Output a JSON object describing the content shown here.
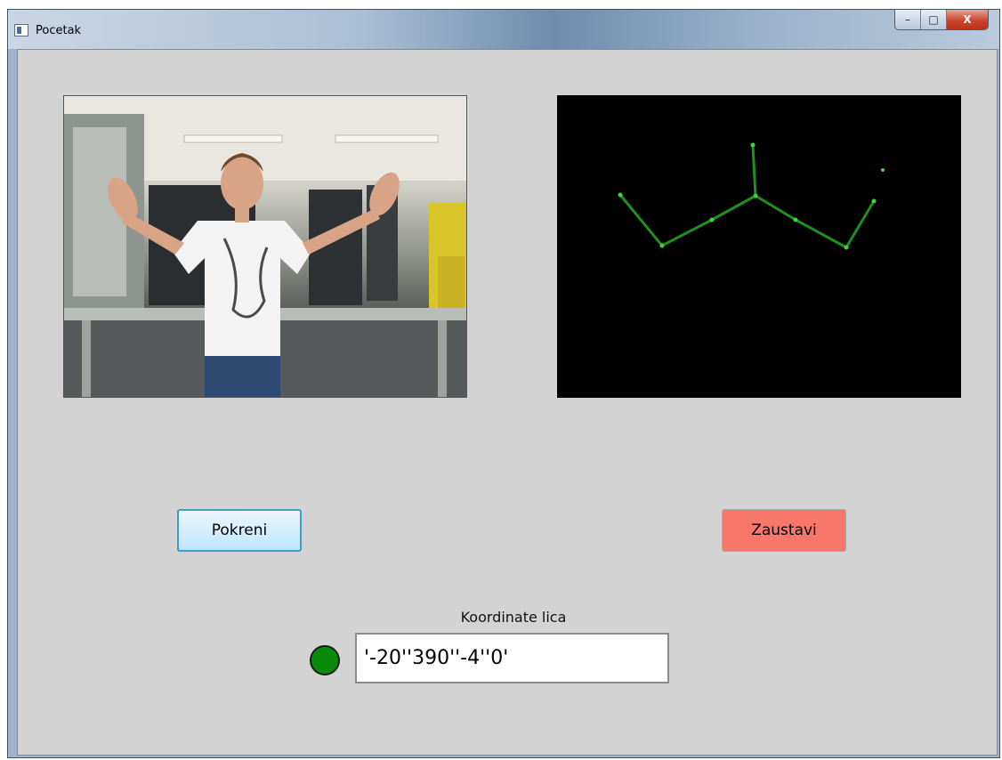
{
  "window": {
    "title": "Pocetak",
    "caption_buttons": {
      "minimize": "–",
      "maximize": "□",
      "close": "X"
    }
  },
  "views": {
    "camera": {
      "icon": "camera-feed"
    },
    "skeleton": {
      "icon": "skeleton-tracking",
      "line_color": "#1f8f1f",
      "joint_color": "#3fd43f"
    }
  },
  "buttons": {
    "start_label": "Pokreni",
    "stop_label": "Zaustavi"
  },
  "coordinates": {
    "label": "Koordinate lica",
    "value": "'-20''390''-4''0'",
    "status_color": "#0a8a0a"
  },
  "colors": {
    "client_bg": "#d3d3d3",
    "start_button_border": "#3c9fcf",
    "stop_button_bg": "#f7786b"
  }
}
